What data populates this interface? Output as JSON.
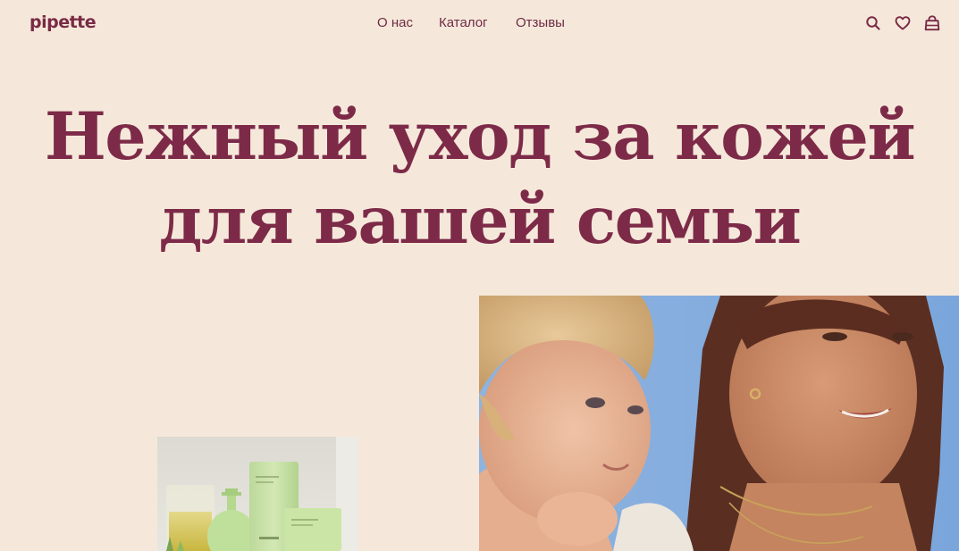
{
  "header": {
    "logo": "pipette",
    "nav": [
      {
        "label": "О нас"
      },
      {
        "label": "Каталог"
      },
      {
        "label": "Отзывы"
      }
    ],
    "icons": [
      "search-icon",
      "heart-icon",
      "bag-icon"
    ]
  },
  "hero": {
    "title_line1": "Нежный уход за кожей",
    "title_line2": "для вашей семьи"
  },
  "colors": {
    "background": "#f5e8da",
    "accent": "#7a2a45"
  }
}
